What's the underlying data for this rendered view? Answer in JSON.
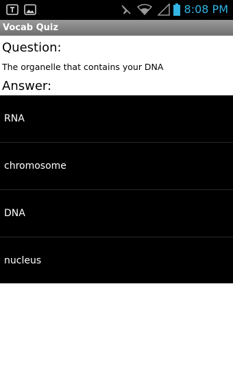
{
  "status_bar": {
    "time": "8:08 PM",
    "icons": [
      "text-notification-icon",
      "gallery-notification-icon",
      "mute-icon",
      "wifi-icon",
      "cell-signal-icon",
      "battery-icon"
    ],
    "time_color": "#33b5e5"
  },
  "app": {
    "title": "Vocab Quiz"
  },
  "quiz": {
    "question_heading": "Question:",
    "question_text": "The organelle that contains your DNA",
    "answer_heading": "Answer:",
    "answers": [
      "RNA",
      "chromosome",
      "DNA",
      "nucleus"
    ]
  }
}
